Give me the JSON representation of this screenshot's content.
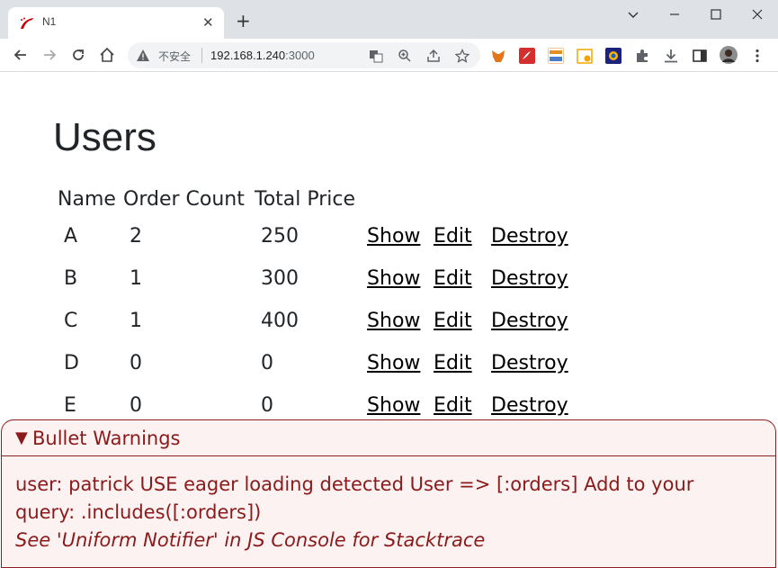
{
  "browser": {
    "tab_title": "N1",
    "tab_close": "✕",
    "new_tab": "+",
    "insecure_label": "不安全",
    "url_host": "192.168.1.240",
    "url_port": ":3000"
  },
  "page": {
    "title": "Users",
    "columns": [
      "Name",
      "Order Count",
      "Total Price"
    ],
    "rows": [
      {
        "name": "A",
        "order_count": "2",
        "total_price": "250"
      },
      {
        "name": "B",
        "order_count": "1",
        "total_price": "300"
      },
      {
        "name": "C",
        "order_count": "1",
        "total_price": "400"
      },
      {
        "name": "D",
        "order_count": "0",
        "total_price": "0"
      },
      {
        "name": "E",
        "order_count": "0",
        "total_price": "0"
      }
    ],
    "actions": {
      "show": "Show",
      "edit": "Edit",
      "destroy": "Destroy"
    }
  },
  "bullet": {
    "arrow": "▼",
    "title": "Bullet Warnings",
    "message": "user: patrick USE eager loading detected User => [:orders] Add to your query: .includes([:orders])",
    "hint": "See 'Uniform Notifier' in JS Console for Stacktrace"
  },
  "colors": {
    "chrome_bg": "#dee1e6",
    "omnibox_bg": "#f1f3f4",
    "bullet_bg": "#fdf2f2",
    "bullet_text": "#8b1a1a"
  }
}
